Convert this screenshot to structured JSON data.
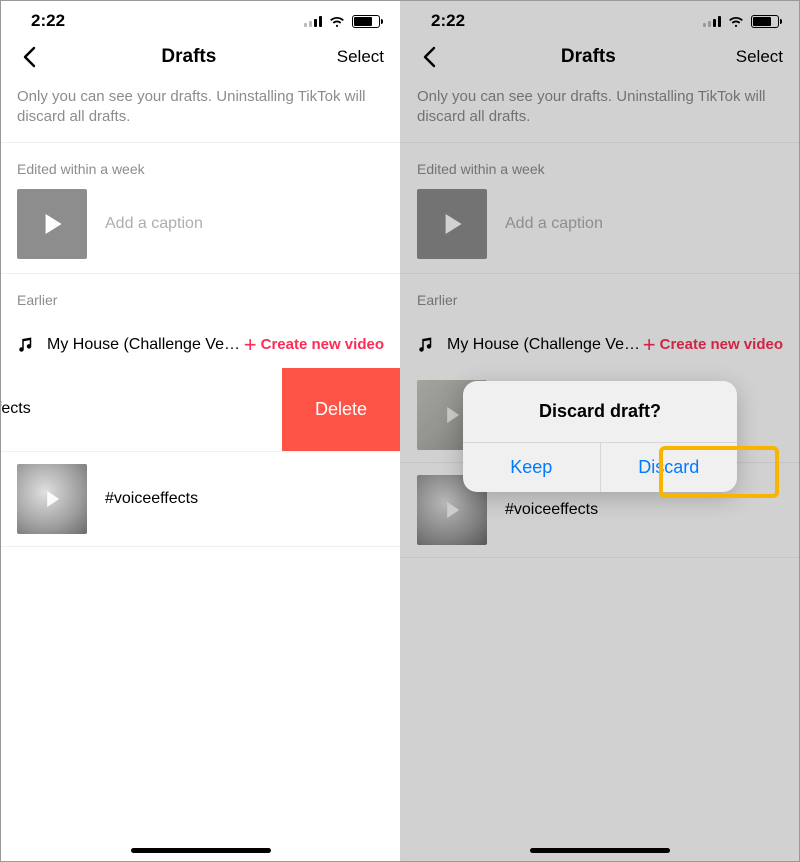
{
  "status": {
    "time": "2:22"
  },
  "header": {
    "title": "Drafts",
    "select": "Select"
  },
  "info": "Only you can see your drafts. Uninstalling TikTok will discard all drafts.",
  "sections": {
    "recent_title": "Edited within a week",
    "earlier_title": "Earlier"
  },
  "drafts": {
    "recent_caption_placeholder": "Add a caption",
    "sound_name": "My House (Challenge Versi...",
    "create_video": "Create new video",
    "swiped_caption": "eeffects",
    "voice_effects": "#voiceeffects"
  },
  "delete_label": "Delete",
  "dialog": {
    "title": "Discard draft?",
    "keep": "Keep",
    "discard": "Discard"
  }
}
